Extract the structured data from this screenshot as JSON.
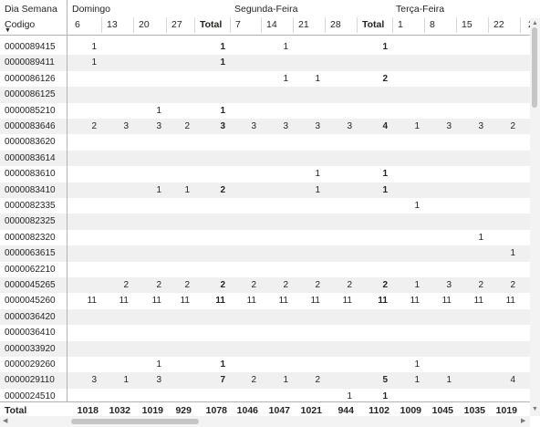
{
  "header": {
    "dia_semana_label": "Dia Semana",
    "codigo_label": "Codigo",
    "groups": [
      {
        "name": "Domingo"
      },
      {
        "name": "Segunda-Feira"
      },
      {
        "name": "Terça-Feira"
      }
    ],
    "columns": [
      "6",
      "13",
      "20",
      "27",
      "Total",
      "7",
      "14",
      "21",
      "28",
      "Total",
      "1",
      "8",
      "15",
      "22",
      "2"
    ]
  },
  "rows": [
    {
      "code": "0000089415",
      "vals": [
        "1",
        "",
        "",
        "",
        "1",
        "",
        "1",
        "",
        "",
        "1",
        "",
        "",
        "",
        ""
      ]
    },
    {
      "code": "0000089411",
      "vals": [
        "1",
        "",
        "",
        "",
        "1",
        "",
        "",
        "",
        "",
        "",
        "",
        "",
        "",
        ""
      ]
    },
    {
      "code": "0000086126",
      "vals": [
        "",
        "",
        "",
        "",
        "",
        "",
        "1",
        "1",
        "",
        "2",
        "",
        "",
        "",
        ""
      ]
    },
    {
      "code": "0000086125",
      "vals": [
        "",
        "",
        "",
        "",
        "",
        "",
        "",
        "",
        "",
        "",
        "",
        "",
        "",
        ""
      ]
    },
    {
      "code": "0000085210",
      "vals": [
        "",
        "",
        "1",
        "",
        "1",
        "",
        "",
        "",
        "",
        "",
        "",
        "",
        "",
        ""
      ]
    },
    {
      "code": "0000083646",
      "vals": [
        "2",
        "3",
        "3",
        "2",
        "3",
        "3",
        "3",
        "3",
        "3",
        "4",
        "1",
        "3",
        "3",
        "2"
      ]
    },
    {
      "code": "0000083620",
      "vals": [
        "",
        "",
        "",
        "",
        "",
        "",
        "",
        "",
        "",
        "",
        "",
        "",
        "",
        ""
      ]
    },
    {
      "code": "0000083614",
      "vals": [
        "",
        "",
        "",
        "",
        "",
        "",
        "",
        "",
        "",
        "",
        "",
        "",
        "",
        ""
      ]
    },
    {
      "code": "0000083610",
      "vals": [
        "",
        "",
        "",
        "",
        "",
        "",
        "",
        "1",
        "",
        "1",
        "",
        "",
        "",
        ""
      ]
    },
    {
      "code": "0000083410",
      "vals": [
        "",
        "",
        "1",
        "1",
        "2",
        "",
        "",
        "1",
        "",
        "1",
        "",
        "",
        "",
        ""
      ]
    },
    {
      "code": "0000082335",
      "vals": [
        "",
        "",
        "",
        "",
        "",
        "",
        "",
        "",
        "",
        "",
        "1",
        "",
        "",
        ""
      ]
    },
    {
      "code": "0000082325",
      "vals": [
        "",
        "",
        "",
        "",
        "",
        "",
        "",
        "",
        "",
        "",
        "",
        "",
        "",
        ""
      ]
    },
    {
      "code": "0000082320",
      "vals": [
        "",
        "",
        "",
        "",
        "",
        "",
        "",
        "",
        "",
        "",
        "",
        "",
        "1",
        ""
      ]
    },
    {
      "code": "0000063615",
      "vals": [
        "",
        "",
        "",
        "",
        "",
        "",
        "",
        "",
        "",
        "",
        "",
        "",
        "",
        "1"
      ]
    },
    {
      "code": "0000062210",
      "vals": [
        "",
        "",
        "",
        "",
        "",
        "",
        "",
        "",
        "",
        "",
        "",
        "",
        "",
        ""
      ]
    },
    {
      "code": "0000045265",
      "vals": [
        "",
        "2",
        "2",
        "2",
        "2",
        "2",
        "2",
        "2",
        "2",
        "2",
        "1",
        "3",
        "2",
        "2"
      ]
    },
    {
      "code": "0000045260",
      "vals": [
        "11",
        "11",
        "11",
        "11",
        "11",
        "11",
        "11",
        "11",
        "11",
        "11",
        "11",
        "11",
        "11",
        "11"
      ]
    },
    {
      "code": "0000036420",
      "vals": [
        "",
        "",
        "",
        "",
        "",
        "",
        "",
        "",
        "",
        "",
        "",
        "",
        "",
        ""
      ]
    },
    {
      "code": "0000036410",
      "vals": [
        "",
        "",
        "",
        "",
        "",
        "",
        "",
        "",
        "",
        "",
        "",
        "",
        "",
        ""
      ]
    },
    {
      "code": "0000033920",
      "vals": [
        "",
        "",
        "",
        "",
        "",
        "",
        "",
        "",
        "",
        "",
        "",
        "",
        "",
        ""
      ]
    },
    {
      "code": "0000029260",
      "vals": [
        "",
        "",
        "1",
        "",
        "1",
        "",
        "",
        "",
        "",
        "",
        "1",
        "",
        "",
        ""
      ]
    },
    {
      "code": "0000029110",
      "vals": [
        "3",
        "1",
        "3",
        "",
        "7",
        "2",
        "1",
        "2",
        "",
        "5",
        "1",
        "1",
        "",
        "4"
      ]
    },
    {
      "code": "0000024510",
      "vals": [
        "",
        "",
        "",
        "",
        "",
        "",
        "",
        "",
        "1",
        "1",
        "",
        "",
        "",
        ""
      ]
    }
  ],
  "totals": {
    "label": "Total",
    "vals": [
      "1018",
      "1032",
      "1019",
      "929",
      "1078",
      "1046",
      "1047",
      "1021",
      "944",
      "1102",
      "1009",
      "1045",
      "1035",
      "1019"
    ]
  },
  "icons": {
    "sort": "sort-down-icon",
    "scroll_up": "chevron-up-icon",
    "scroll_down": "chevron-down-icon",
    "scroll_left": "chevron-left-icon",
    "scroll_right": "chevron-right-icon"
  },
  "colors": {
    "header_line": "#b3b3b3",
    "alt_row": "#f0f0f0",
    "scrollbar_thumb": "#c6c6c6",
    "text": "#252423"
  }
}
